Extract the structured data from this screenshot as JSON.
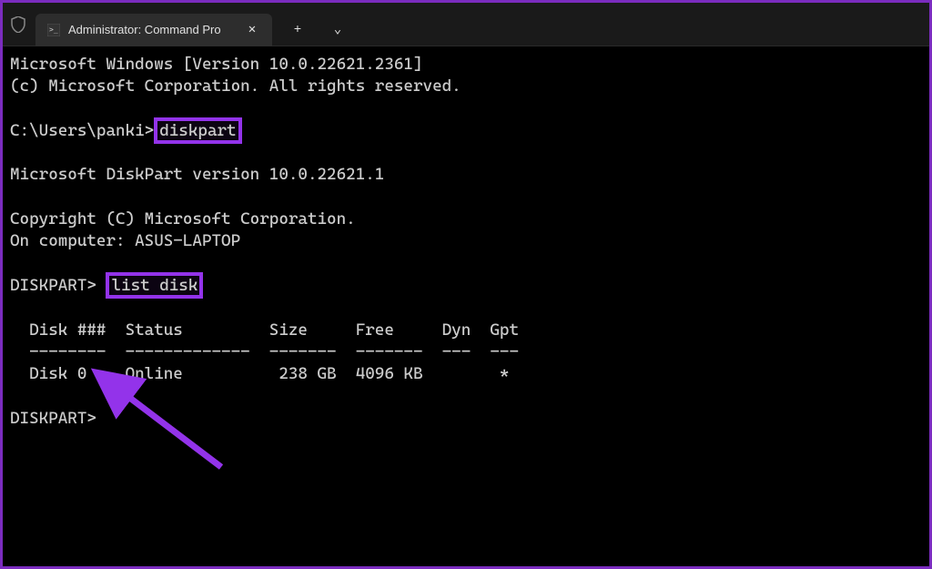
{
  "colors": {
    "highlight": "#9333ea",
    "border": "#7b2cbf",
    "text": "#cccccc",
    "background": "#000000"
  },
  "titlebar": {
    "tab_title": "Administrator: Command Pro",
    "close_label": "✕",
    "new_tab_label": "+",
    "dropdown_label": "⌄"
  },
  "terminal": {
    "line1": "Microsoft Windows [Version 10.0.22621.2361]",
    "line2": "(c) Microsoft Corporation. All rights reserved.",
    "prompt1_path": "C:\\Users\\panki>",
    "prompt1_cmd": "diskpart",
    "line4": "Microsoft DiskPart version 10.0.22621.1",
    "line5": "Copyright (C) Microsoft Corporation.",
    "line6": "On computer: ASUS-LAPTOP",
    "prompt2_label": "DISKPART> ",
    "prompt2_cmd": "list disk",
    "table_header": "  Disk ###  Status         Size     Free     Dyn  Gpt",
    "table_divider": "  --------  -------------  -------  -------  ---  ---",
    "table_row1": "  Disk 0    Online          238 GB  4096 KB        *",
    "prompt3_label": "DISKPART>"
  }
}
